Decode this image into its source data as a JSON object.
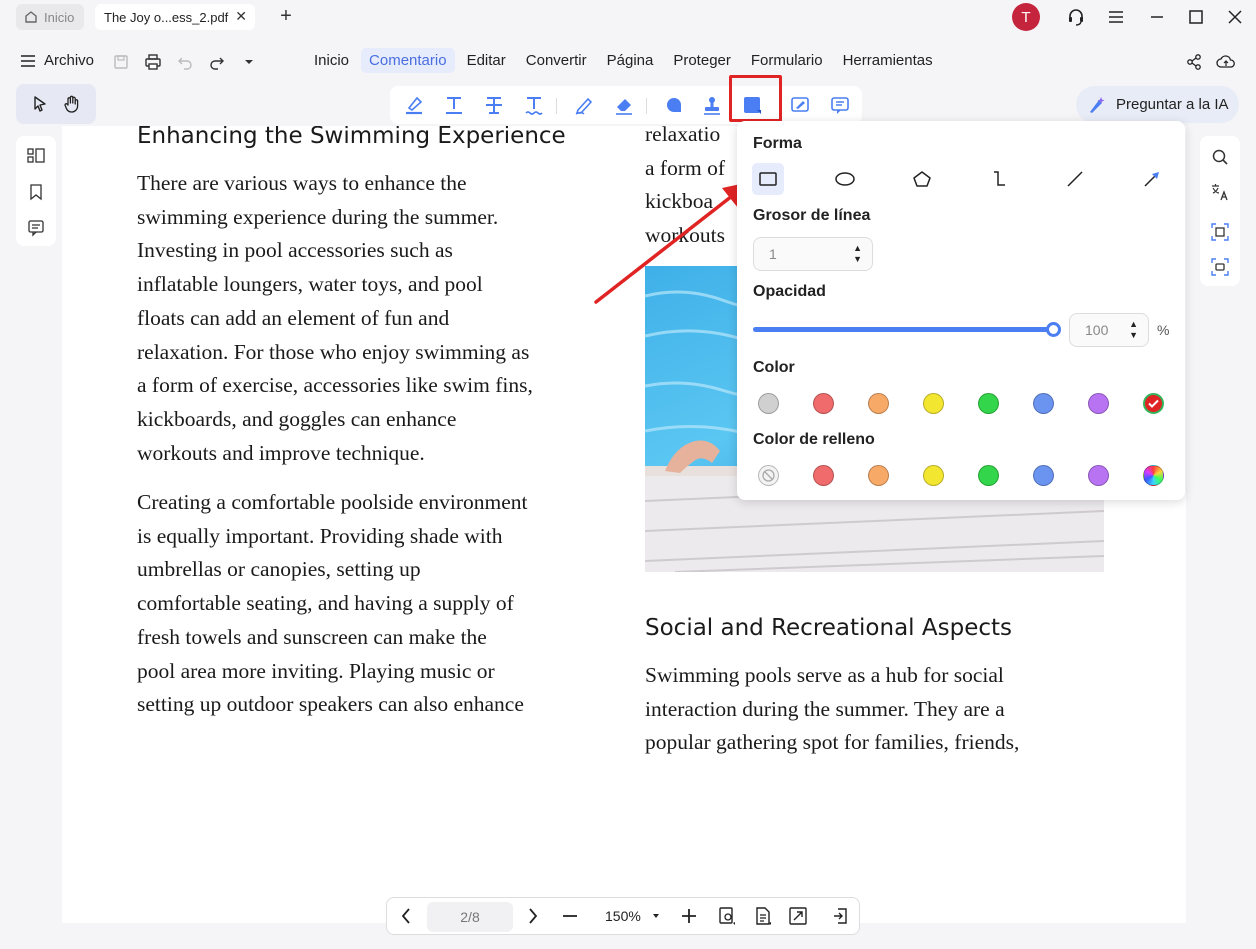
{
  "colors": {
    "accent": "#4a6ee0",
    "highlight_box": "#e02424",
    "avatar_bg": "#c5253c"
  },
  "titlebar": {
    "home_tab": "Inicio",
    "doc_tab": "The Joy o...ess_2.pdf",
    "avatar_letter": "T"
  },
  "menubar": {
    "archivo": "Archivo",
    "items": [
      "Inicio",
      "Comentario",
      "Editar",
      "Convertir",
      "Página",
      "Proteger",
      "Formulario",
      "Herramientas"
    ],
    "active": "Comentario"
  },
  "ai_button": "Preguntar a la IA",
  "document": {
    "left_heading": "Enhancing the Swimming Experience",
    "left_p1": [
      "There are various ways to enhance the",
      "swimming experience during the summer.",
      "Investing in pool accessories such as",
      "inflatable loungers, water toys, and pool",
      "floats can add an element of fun and",
      "relaxation. For those who enjoy swimming as",
      "a form of exercise, accessories like swim fins,",
      "kickboards, and goggles can enhance",
      "workouts and improve technique."
    ],
    "left_p2": [
      "Creating a comfortable poolside environment",
      "is equally important. Providing shade with",
      "umbrellas or canopies, setting up",
      "comfortable seating, and having a supply of",
      "fresh towels and sunscreen can make the",
      "pool area more inviting. Playing music or",
      "setting up outdoor speakers can also enhance"
    ],
    "right_top": [
      "relaxatio",
      "a form of",
      "kickboa",
      "workouts"
    ],
    "right_heading": "Social and Recreational Aspects",
    "right_p": [
      "Swimming pools serve as a hub for social",
      "interaction during the summer. They are a",
      "popular gathering spot for families, friends,"
    ]
  },
  "popup": {
    "shape_label": "Forma",
    "shapes": [
      "rectangle-icon",
      "ellipse-icon",
      "polygon-icon",
      "polyline-icon",
      "line-icon",
      "arrow-icon"
    ],
    "line_width_label": "Grosor de línea",
    "line_width_value": "1",
    "opacity_label": "Opacidad",
    "opacity_value": "100",
    "opacity_unit": "%",
    "opacity_level": 100,
    "color_label": "Color",
    "colors": [
      "#d0d0d0",
      "#f06b6b",
      "#f7a968",
      "#f3e631",
      "#33d64a",
      "#6b93f0",
      "#b873f2",
      "#e02424"
    ],
    "fill_label": "Color de relleno",
    "fill_colors": [
      "none",
      "#f06b6b",
      "#f7a968",
      "#f3e631",
      "#33d64a",
      "#6b93f0",
      "#b873f2",
      "rainbow"
    ]
  },
  "bottombar": {
    "page": "2/8",
    "zoom": "150%"
  }
}
